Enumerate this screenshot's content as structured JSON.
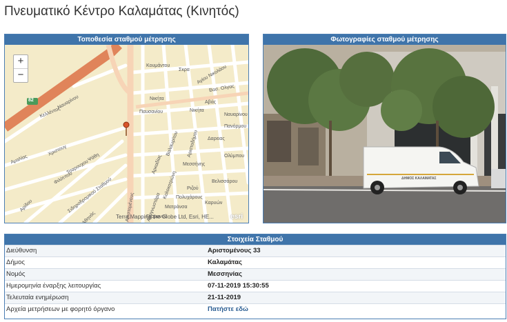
{
  "page": {
    "title": "Πνευματικό Κέντρο Καλαμάτας (Κινητός)"
  },
  "map": {
    "header": "Τοποθεσία σταθμού μέτρησης",
    "zoom_in": "+",
    "zoom_out": "−",
    "attribution": "Terra Mapping the Globe Ltd, Esri, HE...",
    "esri_logo": "esri",
    "road_badge": "82",
    "street_labels": [
      "Κουμάντου",
      "Σκρα",
      "Αγίου Νικολάου",
      "Νικήτα",
      "Βασ. Ολγας",
      "Αβάς",
      "Ναυαρίνου",
      "Νικήτα",
      "Πανόρμου",
      "Παυσανίου",
      "Δαρειας",
      "Ολύμπου",
      "Κελλέντος",
      "Ναυαρίνου",
      "Αμαλίας",
      "Χριστουγ",
      "Φιλίππου",
      "Ψάθη",
      "Τσαρουχου",
      "Σιδηροδρομικού Σταθμού",
      "Αριστομένους",
      "Αναγνωστάρα",
      "Κολοκοτρώνη",
      "Αρκαδίας",
      "Βαλαωρίτου",
      "Μεσσήνης",
      "Ματράνσα",
      "Ριζού",
      "Καρυών",
      "Βελισσάρου",
      "Πολυχάρους",
      "Αριστοδήμου",
      "Γερμανού",
      "Αρίδου",
      "Αθηνάς"
    ],
    "pin_icon": "map-pin-icon"
  },
  "photo": {
    "header": "Φωτογραφίες σταθμού μέτρησης",
    "van_text": "ΔΗΜΟΣ ΚΑΛΑΜΑΤΑΣ"
  },
  "info": {
    "header": "Στοιχεία Σταθμού",
    "rows": [
      {
        "label": "Διεύθυνση",
        "value": "Αριστομένους 33"
      },
      {
        "label": "Δήμος",
        "value": "Καλαμάτας"
      },
      {
        "label": "Νομός",
        "value": "Μεσσηνίας"
      },
      {
        "label": "Ημερομηνία έναρξης λειτουργίας",
        "value": "07-11-2019 15:30:55"
      },
      {
        "label": "Τελευταία ενημέρωση",
        "value": "21-11-2019"
      },
      {
        "label": "Αρχεία μετρήσεων με φορητό όργανο",
        "value": "Πατήστε εδώ"
      }
    ]
  },
  "colors": {
    "header_blue": "#3f74aa",
    "link_blue": "#2a5d92",
    "road_orange": "#e0845a"
  }
}
